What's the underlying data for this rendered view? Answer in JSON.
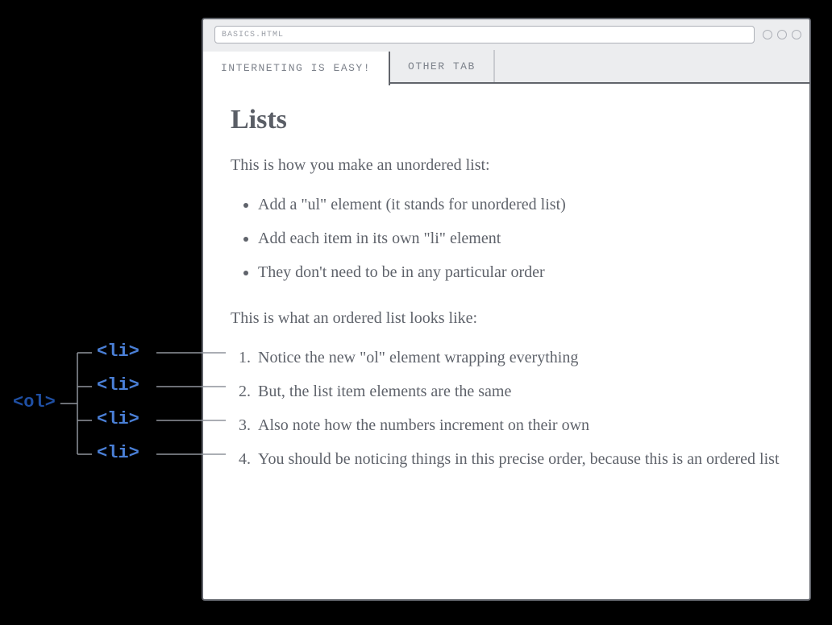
{
  "browser": {
    "address": "BASICS.HTML",
    "tabs": [
      {
        "label": "INTERNETING IS EASY!",
        "active": true
      },
      {
        "label": "OTHER TAB",
        "active": false
      }
    ]
  },
  "page": {
    "heading": "Lists",
    "intro_ul": "This is how you make an unordered list:",
    "ul_items": [
      "Add a \"ul\" element (it stands for unordered list)",
      "Add each item in its own \"li\" element",
      "They don't need to be in any particular order"
    ],
    "intro_ol": "This is what an ordered list looks like:",
    "ol_items": [
      "Notice the new \"ol\" element wrapping everything",
      "But, the list item elements are the same",
      "Also note how the numbers increment on their own",
      "You should be noticing things in this precise order, because this is an ordered list"
    ]
  },
  "annotation": {
    "ol_tag": "<ol>",
    "li_tag": "<li>",
    "colors": {
      "ol": "#1f4fa3",
      "li": "#4a7fd6",
      "connector": "#8f949c"
    }
  }
}
